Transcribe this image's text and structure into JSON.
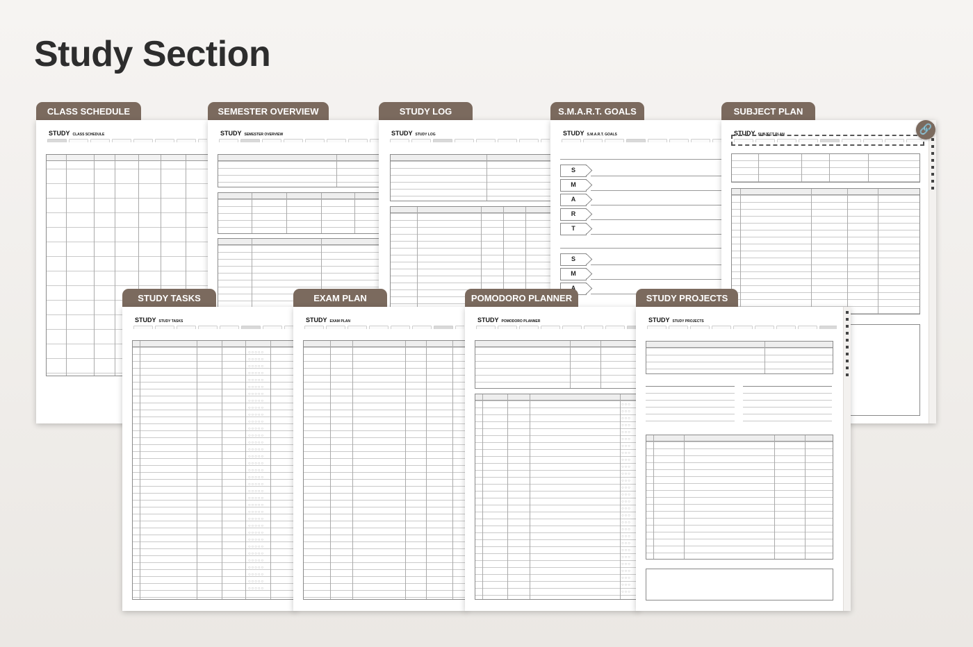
{
  "page": {
    "title": "Study Section"
  },
  "accent_color": "#7b6a5e",
  "header_word": "STUDY",
  "icons": {
    "link": "link-icon"
  },
  "cards": {
    "class_schedule": {
      "tab": "CLASS SCHEDULE",
      "subtitle": "CLASS SCHEDULE"
    },
    "semester_overview": {
      "tab": "SEMESTER OVERVIEW",
      "subtitle": "SEMESTER OVERVIEW"
    },
    "study_log": {
      "tab": "STUDY LOG",
      "subtitle": "STUDY LOG"
    },
    "smart_goals": {
      "tab": "S.M.A.R.T. GOALS",
      "subtitle": "S.M.A.R.T. GOALS",
      "letters": [
        "S",
        "M",
        "A",
        "R",
        "T"
      ]
    },
    "subject_plan": {
      "tab": "SUBJECT PLAN",
      "subtitle": "SUBJECT PLAN"
    },
    "study_tasks": {
      "tab": "STUDY TASKS",
      "subtitle": "STUDY TASKS"
    },
    "exam_plan": {
      "tab": "EXAM PLAN",
      "subtitle": "EXAM PLAN"
    },
    "pomodoro_planner": {
      "tab": "POMODORO PLANNER",
      "subtitle": "POMODORO PLANNER"
    },
    "study_projects": {
      "tab": "STUDY PROJECTS",
      "subtitle": "STUDY PROJECTS"
    }
  }
}
